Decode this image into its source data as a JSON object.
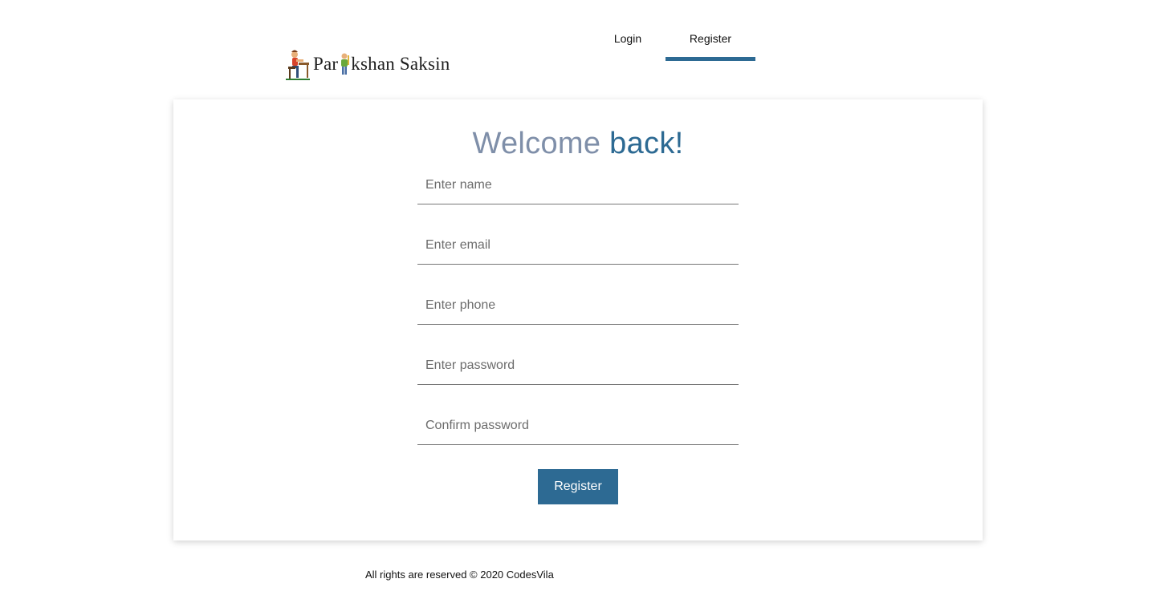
{
  "header": {
    "logo_text_before": "Par",
    "logo_text_after": "kshan Saksin",
    "logo_alt": "Pariksha Saksin",
    "nav": {
      "login_label": "Login",
      "register_label": "Register",
      "active": "register"
    }
  },
  "card": {
    "title_part1": "Welcome",
    "title_part2": "back!",
    "fields": {
      "name_placeholder": "Enter name",
      "email_placeholder": "Enter email",
      "phone_placeholder": "Enter phone",
      "password_placeholder": "Enter password",
      "confirm_password_placeholder": "Confirm password"
    },
    "submit_label": "Register"
  },
  "footer": {
    "text": "All rights are reserved © 2020 CodesVila"
  },
  "colors": {
    "accent": "#2d6a93",
    "title_muted": "#7f8fa9"
  }
}
